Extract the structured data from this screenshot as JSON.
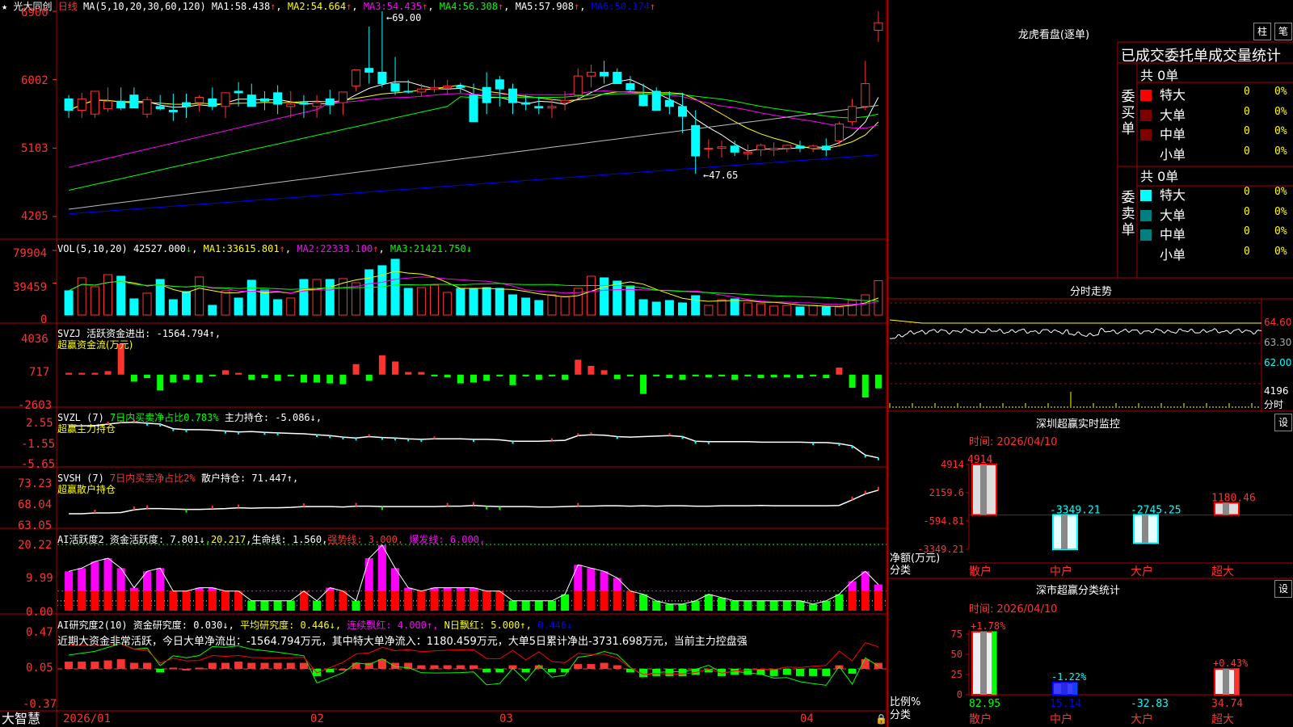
{
  "colors": {
    "up": "#ff3232",
    "down": "#00ffff",
    "grid": "#b00000",
    "dash": "#a00000",
    "ma1": "#ffffff",
    "ma2": "#ffff00",
    "ma3": "#ff00ff",
    "ma4": "#00ff00",
    "ma5": "#bbbbbb",
    "ma6": "#0000ff"
  },
  "header": {
    "star": "★",
    "stock_name": "光大同创",
    "period": "日线",
    "ma_params": "MA(5,10,20,30,60,120)",
    "items": [
      {
        "label": "MA1:",
        "value": "58.438",
        "arrow": "↑",
        "color": "#ffffff"
      },
      {
        "label": "MA2:",
        "value": "54.664",
        "arrow": "↑",
        "color": "#ffff00"
      },
      {
        "label": "MA3:",
        "value": "54.435",
        "arrow": "↑",
        "color": "#ff00ff"
      },
      {
        "label": "MA4:",
        "value": "56.308",
        "arrow": "↑",
        "color": "#00ff00"
      },
      {
        "label": "MA5:",
        "value": "57.908",
        "arrow": "↑",
        "color": "#ffffff"
      },
      {
        "label": "MA6:",
        "value": "50.174",
        "arrow": "↑",
        "color": "#0000ff"
      }
    ],
    "high_marker": "69.00",
    "low_marker": "47.65"
  },
  "price_axis": {
    "labels": [
      "6900",
      "6002",
      "5103",
      "4205"
    ]
  },
  "vol_panel": {
    "title": "VOL(5,10,20)",
    "value": "42527.000",
    "value_arrow": "↓",
    "items": [
      {
        "label": "MA1:",
        "value": "33615.801",
        "arrow": "↑",
        "color": "#ffff00"
      },
      {
        "label": "MA2:",
        "value": "22333.100",
        "arrow": "↑",
        "color": "#ff00ff"
      },
      {
        "label": "MA3:",
        "value": "21421.750",
        "arrow": "↓",
        "color": "#00ff00"
      }
    ],
    "axis": [
      "79904",
      "39459",
      "0"
    ]
  },
  "svzj_panel": {
    "line1": "SVZJ  活跃资金进出: -1564.794↑,",
    "line2": "超赢资金流(万元)",
    "axis": [
      "4036",
      "717",
      "-2603"
    ]
  },
  "svzl_panel": {
    "line1a": "SVZL (7)",
    "line1b": "7日内买卖净占比0.783%",
    "line1c": "主力持仓: -5.086↓,",
    "line2": "超赢主力持仓",
    "axis": [
      "2.55",
      "-1.55",
      "-5.65"
    ]
  },
  "svsh_panel": {
    "line1a": "SVSH (7)",
    "line1b": "7日内买卖净占比2%",
    "line1c": "散户持仓: 71.447↑,",
    "line2": "超赢散户持仓",
    "axis": [
      "73.23",
      "68.04",
      "63.05"
    ]
  },
  "ai1_panel": {
    "line_a": "AI活跃度2 资金活跃度: 7.801↓",
    "line_b": "20.217",
    "line_c": ",生命线: 1.560,",
    "line_d": "强势线: 3.000,",
    "line_e": "爆发线: 6.000,",
    "axis": [
      "20.22",
      "9.99",
      "0.00"
    ]
  },
  "ai2_panel": {
    "line_a": "AI研究度2(10) 资金研究度: 0.030↓,",
    "line_b": "平均研究度: 0.446↓,",
    "line_c": "连续飘红: 4.000↑,",
    "line_d": "N日飘红: 5.000↑,",
    "line_e": "0.446↓",
    "comment": "近期大资金非常活跃，今日大单净流出：-1564.794万元，其中特大单净流入：1180.459万元，大单5日累计净出-3731.698万元，当前主力控盘强",
    "axis": [
      "0.47",
      "0.05",
      "-0.37"
    ]
  },
  "footer": {
    "brand": "大智慧",
    "months": [
      "2026/01",
      "02",
      "03",
      "04"
    ]
  },
  "longhu": {
    "title": "龙虎看盘(逐单)",
    "btn1": "柱",
    "btn2": "笔",
    "subtitle": "已成交委托单成交量统计",
    "buy_label": "委买单",
    "sell_label": "委卖单",
    "buy_total": "共 0单",
    "sell_total": "共 0单",
    "rows": [
      "特大",
      "大单",
      "中单",
      "小单"
    ],
    "buy_colors": [
      "#ff0000",
      "#800000",
      "#800000",
      ""
    ],
    "sell_colors": [
      "#00ffff",
      "#008080",
      "#008080",
      ""
    ],
    "count": "0",
    "pct": "0%"
  },
  "fenshi": {
    "title": "分时走势",
    "axis": [
      "64.60",
      "63.30",
      "62.00",
      "4196",
      "分时"
    ]
  },
  "sz_monitor": {
    "title": "深圳超赢实时监控",
    "btn": "设",
    "date": "时间: 2026/04/10",
    "axis": [
      "4914",
      "2159.6",
      "-594.81",
      "-3349.21"
    ],
    "ylabel": "净额(万元)",
    "xlabel": "分类",
    "categories": [
      "散户",
      "中户",
      "大户",
      "超大"
    ],
    "labels": [
      "4914",
      "-3349.21",
      "-2745.25",
      "1180.46"
    ]
  },
  "sz_class": {
    "title": "深市超赢分类统计",
    "btn": "设",
    "date": "时间: 2026/04/10",
    "axis": [
      "75",
      "50",
      "25",
      "0"
    ],
    "ylabel": "比例%",
    "xlabel": "分类",
    "categories": [
      "散户",
      "中户",
      "大户",
      "超大"
    ],
    "top_labels": [
      "+1.78%",
      "-1.22%",
      "",
      "+0.43%"
    ],
    "bottom_labels": [
      "82.95",
      "15.14",
      "-32.83",
      "34.74"
    ]
  },
  "chart_data": [
    {
      "type": "candlestick",
      "title": "光大同创 日线",
      "ylim": [
        42.05,
        69.0
      ],
      "o": [
        57.5,
        56.0,
        55.5,
        56.2,
        57.2,
        58.0,
        55.5,
        56.5,
        56.0,
        57.0,
        57.0,
        57.5,
        56.5,
        58.5,
        58.0,
        57.5,
        58.3,
        56.5,
        57.0,
        56.5,
        57.5,
        57.0,
        59.2,
        61.5,
        61.0,
        59.5,
        58.5,
        58.4,
        58.8,
        59.0,
        59.2,
        58.0,
        59.0,
        60.0,
        58.8,
        57.0,
        56.5,
        56.3,
        57.0,
        58.0,
        60.5,
        61.0,
        61.0,
        59.5,
        58.0,
        58.5,
        57.3,
        56.5,
        54.0,
        51.0,
        51.0,
        51.3,
        50.3,
        50.8,
        50.8,
        51.0,
        51.3,
        51.0,
        51.3,
        52.0,
        54.5,
        56.5,
        66.5
      ],
      "h": [
        58.0,
        58.3,
        58.3,
        59.0,
        59.0,
        59.0,
        57.8,
        58.0,
        58.2,
        58.2,
        58.0,
        59.0,
        57.8,
        59.7,
        59.5,
        58.5,
        59.3,
        58.5,
        58.0,
        58.0,
        58.7,
        58.3,
        60.5,
        67.0,
        69.0,
        63.0,
        60.0,
        59.5,
        60.0,
        60.0,
        59.6,
        59.5,
        61.0,
        60.5,
        59.5,
        58.0,
        57.8,
        57.4,
        58.5,
        61.5,
        62.0,
        62.5,
        61.5,
        60.5,
        59.5,
        59.0,
        58.5,
        58.3,
        56.0,
        52.2,
        52.0,
        52.0,
        51.5,
        51.6,
        51.8,
        51.5,
        52.0,
        51.5,
        52.3,
        54.5,
        57.5,
        62.5,
        69.0
      ],
      "l": [
        55.0,
        55.0,
        55.0,
        55.8,
        56.0,
        57.0,
        55.0,
        56.0,
        54.6,
        55.0,
        55.8,
        56.0,
        55.0,
        56.5,
        57.0,
        56.0,
        55.5,
        55.0,
        55.0,
        55.0,
        55.5,
        55.4,
        58.5,
        59.5,
        59.0,
        58.0,
        58.2,
        57.8,
        58.3,
        58.2,
        58.3,
        54.5,
        55.5,
        56.5,
        55.5,
        56.0,
        55.5,
        55.0,
        56.0,
        57.5,
        59.0,
        59.5,
        59.5,
        58.5,
        56.5,
        56.0,
        55.5,
        53.0,
        47.65,
        49.7,
        49.8,
        50.0,
        49.5,
        50.0,
        50.0,
        50.5,
        50.5,
        50.5,
        50.0,
        51.5,
        54.0,
        56.0,
        65.0
      ],
      "c": [
        56.0,
        57.5,
        58.5,
        57.2,
        56.3,
        56.3,
        57.4,
        56.2,
        55.8,
        56.5,
        57.7,
        56.5,
        58.3,
        58.3,
        56.5,
        57.2,
        56.8,
        56.8,
        56.8,
        57.0,
        56.7,
        58.4,
        61.3,
        61.0,
        59.5,
        58.5,
        58.4,
        58.8,
        59.0,
        59.2,
        59.0,
        54.5,
        57.0,
        58.8,
        57.0,
        56.8,
        56.3,
        56.5,
        57.3,
        60.5,
        61.0,
        60.5,
        59.5,
        58.7,
        56.6,
        56.0,
        56.5,
        55.2,
        50.0,
        51.0,
        51.2,
        50.5,
        50.5,
        51.4,
        51.0,
        51.4,
        51.0,
        51.3,
        50.8,
        54.2,
        56.5,
        59.5,
        67.5
      ]
    },
    {
      "type": "bar",
      "title": "VOL(5,10,20)",
      "values": [
        30000,
        46000,
        35000,
        50000,
        48000,
        20000,
        27000,
        44000,
        19000,
        29000,
        47000,
        12000,
        30000,
        21000,
        43000,
        31000,
        19000,
        21000,
        44000,
        44000,
        44000,
        45000,
        40000,
        56000,
        61000,
        69000,
        33000,
        34000,
        37000,
        28000,
        33000,
        33000,
        34000,
        33000,
        25000,
        21000,
        18000,
        25000,
        23000,
        33000,
        48000,
        46000,
        42000,
        36000,
        19000,
        16000,
        18000,
        15000,
        24000,
        12000,
        19000,
        20000,
        15000,
        14000,
        11000,
        12000,
        10000,
        12000,
        10000,
        10000,
        18000,
        25000,
        42527
      ]
    },
    {
      "type": "bar",
      "title": "超赢资金流(万元)",
      "values": [
        200,
        200,
        200,
        400,
        3500,
        -800,
        -400,
        -1800,
        -900,
        -600,
        -900,
        -200,
        500,
        200,
        -600,
        -400,
        -700,
        -200,
        -900,
        -900,
        -1000,
        -1100,
        1200,
        -700,
        2200,
        1500,
        300,
        300,
        -200,
        -300,
        -1000,
        -900,
        -700,
        -200,
        -1200,
        -200,
        -600,
        -200,
        -600,
        1700,
        1000,
        500,
        -500,
        -200,
        -2200,
        -200,
        -400,
        -600,
        -200,
        -300,
        -200,
        -600,
        -200,
        -400,
        -300,
        -300,
        -400,
        -200,
        -400,
        800,
        -1500,
        -2603,
        -1565
      ]
    },
    {
      "type": "line",
      "title": "超赢主力持仓",
      "values": [
        1.8,
        1.8,
        1.9,
        2.2,
        2.5,
        2.6,
        2.4,
        2.2,
        1.2,
        1.0,
        1.0,
        0.9,
        0.7,
        0.5,
        0.6,
        0.4,
        0.3,
        0.2,
        0.1,
        -0.1,
        -0.3,
        -0.6,
        -0.8,
        -0.5,
        -0.7,
        -0.8,
        -1.0,
        -1.1,
        -1.0,
        -1.0,
        -1.0,
        -1.1,
        -1.1,
        -1.2,
        -1.5,
        -1.5,
        -1.5,
        -1.4,
        -1.3,
        -0.3,
        -0.1,
        -0.2,
        -0.5,
        -0.6,
        -0.5,
        -0.4,
        -0.3,
        -0.5,
        -1.5,
        -1.6,
        -1.6,
        -1.6,
        -1.6,
        -1.7,
        -1.7,
        -1.7,
        -1.7,
        -1.8,
        -1.8,
        -2.0,
        -2.5,
        -4.5,
        -5.086
      ]
    },
    {
      "type": "line",
      "title": "超赢散户持仓",
      "values": [
        65.5,
        65.5,
        65.7,
        65.7,
        65.8,
        66.5,
        66.8,
        66.8,
        66.7,
        66.6,
        66.6,
        66.7,
        66.8,
        67.0,
        66.9,
        67.0,
        67.0,
        67.1,
        67.3,
        67.3,
        67.3,
        67.2,
        67.4,
        67.4,
        67.3,
        67.3,
        67.3,
        67.3,
        67.3,
        67.4,
        67.4,
        67.6,
        67.4,
        67.3,
        67.3,
        67.3,
        67.2,
        67.2,
        67.3,
        67.4,
        67.4,
        67.5,
        67.5,
        67.4,
        67.5,
        67.4,
        67.5,
        67.5,
        67.4,
        67.4,
        67.5,
        67.5,
        67.5,
        67.6,
        67.5,
        67.5,
        67.5,
        67.5,
        67.5,
        67.6,
        69.0,
        70.5,
        71.447
      ]
    },
    {
      "type": "bar",
      "title": "AI活跃度2",
      "values": [
        12,
        13,
        15,
        16,
        13,
        7,
        12,
        13,
        6,
        6,
        7,
        7,
        6,
        6,
        3,
        3,
        3,
        3,
        6,
        3,
        7,
        6,
        3,
        16,
        20,
        13,
        7,
        6,
        7,
        7,
        7,
        7,
        6,
        6,
        3,
        3,
        3,
        3,
        5,
        14,
        13,
        12,
        10,
        6,
        5,
        3,
        2,
        2,
        3,
        5,
        4,
        3,
        3,
        3,
        3,
        3,
        3,
        2,
        3,
        5,
        9,
        12,
        8
      ],
      "lifeline": 1.56,
      "strongline": 3.0,
      "burstline": 6.0,
      "ylim": [
        0,
        20.22
      ]
    },
    {
      "type": "bar",
      "title": "AI研究度2(10)",
      "values": [
        0.06,
        0.06,
        0.06,
        0.07,
        0.08,
        0.05,
        0.05,
        -0.03,
        0.01,
        0.0,
        0.01,
        0.05,
        0.05,
        0.06,
        0.05,
        0.05,
        0.05,
        0.05,
        0.05,
        -0.06,
        -0.03,
        0.0,
        0.05,
        0.05,
        0.08,
        0.05,
        0.05,
        0.03,
        0.03,
        0.03,
        0.03,
        0.03,
        -0.03,
        -0.03,
        0.03,
        -0.03,
        0.03,
        -0.03,
        -0.03,
        0.04,
        0.04,
        0.05,
        0.03,
        -0.03,
        -0.07,
        -0.06,
        -0.06,
        -0.06,
        -0.05,
        -0.03,
        -0.06,
        -0.05,
        -0.05,
        -0.05,
        -0.06,
        -0.05,
        -0.06,
        -0.06,
        -0.06,
        0.03,
        -0.04,
        0.08,
        0.05
      ],
      "ylim": [
        -0.37,
        0.47
      ]
    }
  ]
}
